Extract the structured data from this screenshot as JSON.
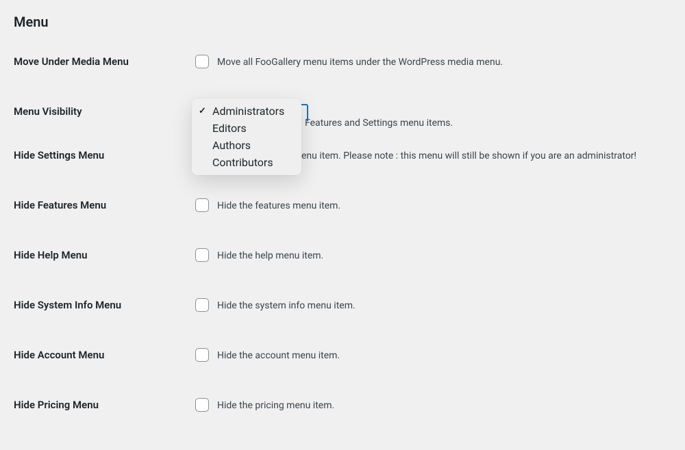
{
  "section_title": "Menu",
  "rows": {
    "move_under_media": {
      "label": "Move Under Media Menu",
      "description": "Move all FooGallery menu items under the WordPress media menu."
    },
    "menu_visibility": {
      "label": "Menu Visibility",
      "description_partial": "Features and Settings menu items.",
      "options": {
        "administrators": "Administrators",
        "editors": "Editors",
        "authors": "Authors",
        "contributors": "Contributors"
      },
      "selected": "Administrators"
    },
    "hide_settings": {
      "label": "Hide Settings Menu",
      "description_partial": "enu item. Please note : this menu will still be shown if you are an administrator!"
    },
    "hide_features": {
      "label": "Hide Features Menu",
      "description": "Hide the features menu item."
    },
    "hide_help": {
      "label": "Hide Help Menu",
      "description": "Hide the help menu item."
    },
    "hide_system_info": {
      "label": "Hide System Info Menu",
      "description": "Hide the system info menu item."
    },
    "hide_account": {
      "label": "Hide Account Menu",
      "description": "Hide the account menu item."
    },
    "hide_pricing": {
      "label": "Hide Pricing Menu",
      "description": "Hide the pricing menu item."
    }
  }
}
